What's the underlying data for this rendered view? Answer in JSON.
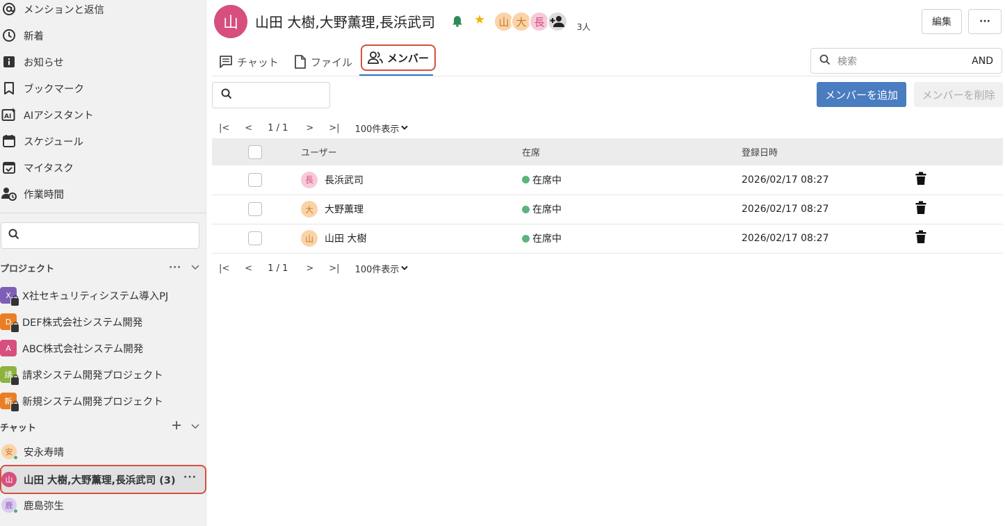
{
  "sidebar": {
    "nav": [
      {
        "icon": "at-sign-icon",
        "label": "メンションと返信"
      },
      {
        "icon": "clock-icon",
        "label": "新着"
      },
      {
        "icon": "info-icon",
        "label": "お知らせ"
      },
      {
        "icon": "bookmark-icon",
        "label": "ブックマーク"
      },
      {
        "icon": "ai-assistant-icon",
        "label": "AIアシスタント"
      },
      {
        "icon": "calendar-icon",
        "label": "スケジュール"
      },
      {
        "icon": "task-icon",
        "label": "マイタスク"
      },
      {
        "icon": "work-time-icon",
        "label": "作業時間"
      }
    ],
    "projects_heading": "プロジェクト",
    "projects": [
      {
        "badge": "X",
        "color": "#7e5fb5",
        "label": "X社セキュリティシステム導入PJ",
        "locked": true
      },
      {
        "badge": "D",
        "color": "#e87f26",
        "label": "DEF株式会社システム開発",
        "locked": true
      },
      {
        "badge": "A",
        "color": "#d64f7f",
        "label": "ABC株式会社システム開発",
        "locked": false
      },
      {
        "badge": "請",
        "color": "#8cb33f",
        "label": "請求システム開発プロジェクト",
        "locked": true
      },
      {
        "badge": "新",
        "color": "#e87f26",
        "label": "新規システム開発プロジェクト",
        "locked": true
      }
    ],
    "chats_heading": "チャット",
    "chats": [
      {
        "avatar": "安",
        "bg": "#fbd3a8",
        "fg": "#c47a2c",
        "label": "安永寿晴",
        "online": true,
        "active": false
      },
      {
        "avatar": "山",
        "bg": "#d64f7f",
        "fg": "#ffffff",
        "label": "山田 大樹,大野薫理,長浜武司 (3)",
        "online": false,
        "active": true
      },
      {
        "avatar": "鹿",
        "bg": "#dccbef",
        "fg": "#7e5fb5",
        "label": "鹿島弥生",
        "online": true,
        "active": false
      }
    ]
  },
  "header": {
    "avatar": "山",
    "title": "山田 大樹,大野薫理,長浜武司",
    "member_avatars": [
      {
        "text": "山",
        "bg": "#fbd3a8",
        "fg": "#c47a2c"
      },
      {
        "text": "大",
        "bg": "#fbd3a8",
        "fg": "#c47a2c"
      },
      {
        "text": "長",
        "bg": "#f7c9d9",
        "fg": "#d64f7f"
      }
    ],
    "member_count": "3人",
    "edit_label": "編集",
    "more_label": "···"
  },
  "tabs": [
    {
      "icon": "chat-icon",
      "label": "チャット"
    },
    {
      "icon": "file-icon",
      "label": "ファイル"
    },
    {
      "icon": "members-icon",
      "label": "メンバー"
    }
  ],
  "search": {
    "placeholder": "検索",
    "mode": "AND"
  },
  "toolbar": {
    "add_label": "メンバーを追加",
    "remove_label": "メンバーを削除"
  },
  "pager": {
    "first": "|<",
    "prev": "<",
    "info": "1 / 1",
    "next": ">",
    "last": ">|",
    "page_size": "100件表示"
  },
  "table": {
    "columns": [
      "ユーザー",
      "在席",
      "登録日時"
    ],
    "rows": [
      {
        "avatar": "長",
        "bg": "#f7c9d9",
        "fg": "#d64f7f",
        "name": "長浜武司",
        "status": "在席中",
        "date": "2026/02/17 08:27"
      },
      {
        "avatar": "大",
        "bg": "#fbd3a8",
        "fg": "#c47a2c",
        "name": "大野薫理",
        "status": "在席中",
        "date": "2026/02/17 08:27"
      },
      {
        "avatar": "山",
        "bg": "#fbd3a8",
        "fg": "#c47a2c",
        "name": "山田 大樹",
        "status": "在席中",
        "date": "2026/02/17 08:27"
      }
    ]
  }
}
